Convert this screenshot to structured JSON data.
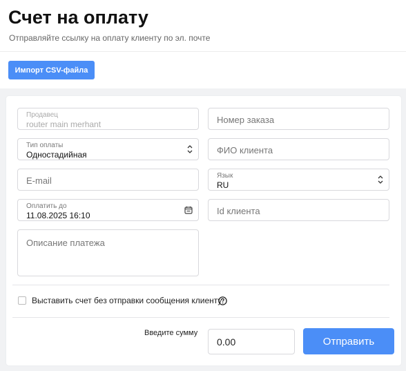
{
  "header": {
    "title": "Счет на оплату",
    "subtitle": "Отправляйте ссылку на оплату клиенту по эл. почте"
  },
  "toolbar": {
    "import_label": "Импорт CSV-файла"
  },
  "form": {
    "seller": {
      "label": "Продавец",
      "value": "router main merhant"
    },
    "order_number": {
      "placeholder": "Номер заказа"
    },
    "payment_type": {
      "label": "Тип оплаты",
      "value": "Одностадийная"
    },
    "client_name": {
      "placeholder": "ФИО клиента"
    },
    "email": {
      "placeholder": "E-mail"
    },
    "language": {
      "label": "Язык",
      "value": "RU"
    },
    "pay_until": {
      "label": "Оплатить до",
      "value": "11.08.2025 16:10"
    },
    "client_id": {
      "placeholder": "Id клиента"
    },
    "description": {
      "placeholder": "Описание платежа"
    },
    "no_notify_checkbox": {
      "label": "Выставить счет без отправки сообщения клиенту",
      "checked": false
    },
    "amount": {
      "label": "Введите сумму",
      "value": "0.00"
    },
    "submit_label": "Отправить"
  },
  "colors": {
    "accent": "#4b8ef7"
  },
  "icons": {
    "select_caret": "chevron-up-down-icon",
    "calendar": "calendar-icon",
    "help": "question-circle-icon"
  }
}
